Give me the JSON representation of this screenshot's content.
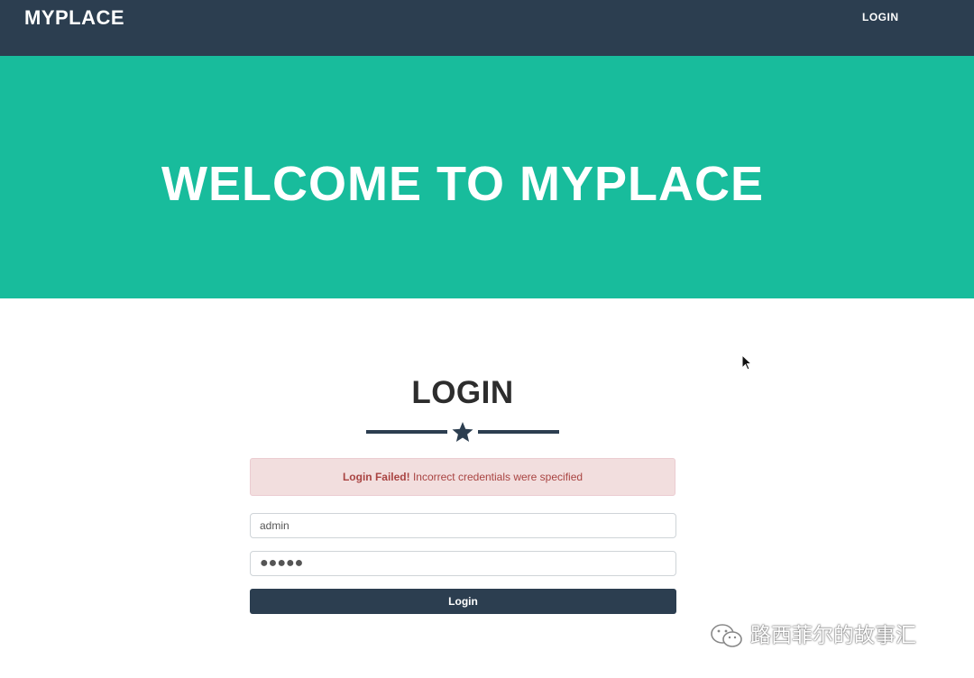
{
  "navbar": {
    "brand": "MYPLACE",
    "login_link": "LOGIN"
  },
  "hero": {
    "title": "WELCOME TO MYPLACE"
  },
  "login": {
    "heading": "LOGIN",
    "alert": {
      "strong": "Login Failed!",
      "message": " Incorrect credentials were specified"
    },
    "username_value": "admin",
    "password_value": "●●●●●",
    "submit_label": "Login"
  },
  "watermark": {
    "text": "路西菲尔的故事汇"
  },
  "colors": {
    "navbar": "#2c3e50",
    "hero": "#18bc9c",
    "alert_bg": "#f2dede",
    "alert_text": "#a94442"
  },
  "icons": {
    "divider": "star-icon",
    "watermark": "wechat-icon",
    "cursor": "mouse-cursor-icon"
  }
}
